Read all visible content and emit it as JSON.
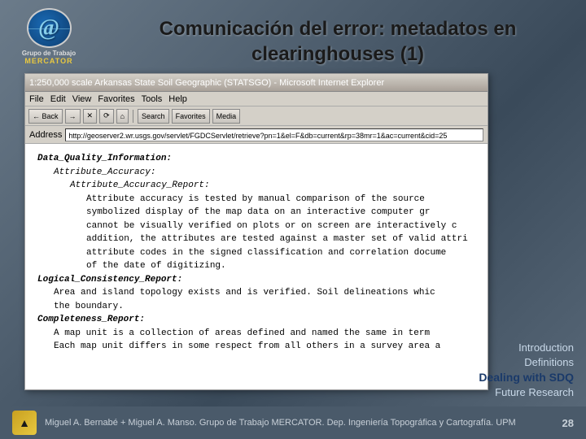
{
  "slide": {
    "title_line1": "Comunicación del error: metadatos en",
    "title_line2": "clearinghouses (1)"
  },
  "logo": {
    "grupo_label": "Grupo de Trabajo",
    "mercator_label": "MERCATOR",
    "at_symbol": "@"
  },
  "browser": {
    "titlebar": "1:250,000 scale Arkansas State Soil Geographic (STATSGO) - Microsoft Internet Explorer",
    "menu_items": [
      "File",
      "Edit",
      "View",
      "Favorites",
      "Tools",
      "Help"
    ],
    "back_btn": "← Back",
    "forward_btn": "→",
    "stop_btn": "✕",
    "refresh_btn": "⟳",
    "home_btn": "🏠",
    "search_btn": "Search",
    "favorites_btn": "Favorites",
    "media_btn": "Media",
    "address_label": "Address",
    "address_url": "http://geoserver2.wr.usgs.gov/servlet/FGDCServlet/retrieve?pn=1&el=F&db=current&rp=38mr=1&ac=current&cid=25",
    "content": {
      "line1": "Data_Quality_Information:",
      "line2": "Attribute_Accuracy:",
      "line3": "Attribute_Accuracy_Report:",
      "line4": "Attribute accuracy is tested by manual comparison of the source",
      "line5": "symbolized display of the map data on an interactive computer gr",
      "line6": "cannot be visually verified on plots or on screen are interactively c",
      "line7": "addition, the attributes are tested against a master set of valid attri",
      "line8": "attribute codes in the signed classification and correlation docume",
      "line9": "of the date of digitizing.",
      "line10": "Logical_Consistency_Report:",
      "line11": "Area and island topology exists and is verified. Soil delineations whic",
      "line12": "the boundary.",
      "line13": "Completeness_Report:",
      "line14": "A map unit is a collection of areas defined and named the same in term",
      "line15": "Each map unit differs in some respect from all others in a survey area a"
    }
  },
  "right_nav": {
    "items": [
      {
        "label": "Introduction",
        "active": false
      },
      {
        "label": "Definitions",
        "active": false
      },
      {
        "label": "Dealing with SDQ",
        "active": true
      },
      {
        "label": "Future Research",
        "active": false
      }
    ]
  },
  "bottom_bar": {
    "author_text": "Miguel A. Bernabé + Miguel A. Manso. Grupo de Trabajo MERCATOR. Dep. Ingeniería Topográfica y Cartografía. UPM",
    "slide_number": "28"
  }
}
